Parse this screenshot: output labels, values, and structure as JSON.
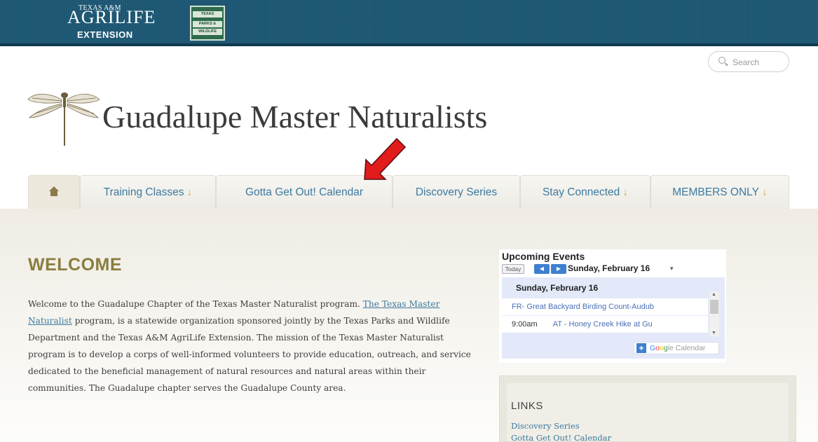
{
  "header": {
    "agrilife": {
      "line1": "TEXAS A&M",
      "line2": "AGRILIFE",
      "line3": "EXTENSION"
    },
    "tpwd": {
      "line1": "TEXAS",
      "line2": "PARKS &",
      "line3": "WILDLIFE"
    },
    "search_label": "Search"
  },
  "site": {
    "title": "Guadalupe Master Naturalists"
  },
  "nav": {
    "tabs": [
      {
        "label": "Training Classes",
        "arrow": "↓"
      },
      {
        "label": "Gotta Get Out! Calendar",
        "arrow": ""
      },
      {
        "label": "Discovery Series",
        "arrow": ""
      },
      {
        "label": "Stay Connected",
        "arrow": "↓"
      },
      {
        "label": "MEMBERS ONLY",
        "arrow": "↓"
      }
    ]
  },
  "welcome": {
    "heading": "WELCOME",
    "p_start": "Welcome to the Guadalupe Chapter of the Texas Master Naturalist program.  ",
    "link1": "The Texas Master Naturalist",
    "p_rest": " program, is a statewide organization sponsored jointly by the Texas Parks and Wildlife Department and the Texas A&M AgriLife Extension. The mission of the Texas Master Naturalist program is to develop a corps of well-informed volunteers to provide education, outreach, and service dedicated to the beneficial management of natural resources and natural areas within their communities. The Guadalupe chapter serves the Guadalupe County area."
  },
  "events": {
    "title": "Upcoming Events",
    "today_label": "Today",
    "prev_label": "◀",
    "next_label": "▶",
    "date_label": "Sunday, February 16",
    "dropdown": "▾",
    "day_heading": "Sunday, February 16",
    "rows": [
      {
        "time": "",
        "event": "FR- Great Backyard Birding Count-Audub"
      },
      {
        "time": "9:00am",
        "event": "AT - Honey Creek Hike at Gu"
      }
    ],
    "gcal": {
      "plus": "+",
      "g1": "G",
      "g2": "o",
      "g3": "o",
      "g4": "g",
      "rest": "le Calendar"
    }
  },
  "links": {
    "heading": "LINKS",
    "items": [
      "Discovery Series",
      "Gotta Get Out! Calendar"
    ]
  },
  "colors": {
    "header_bg": "#1c5672",
    "link": "#3d7aa0",
    "heading": "#8b7d3f",
    "annotation_arrow": "#e21b1b"
  }
}
